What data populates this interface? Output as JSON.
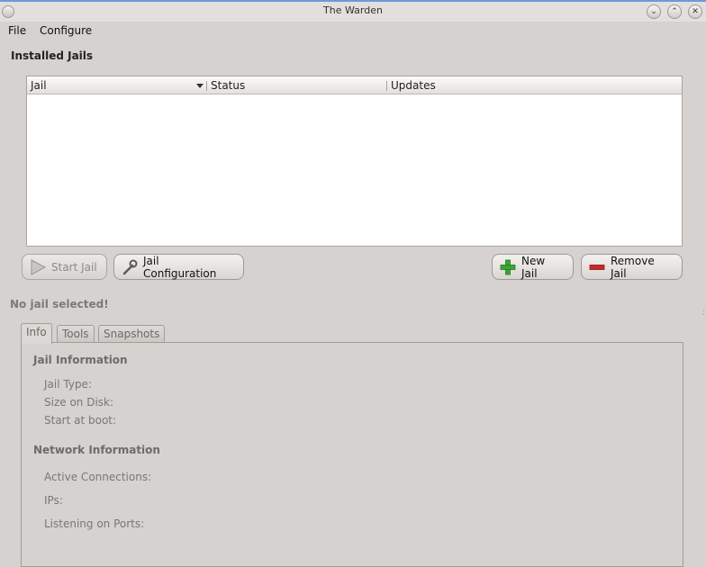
{
  "window": {
    "title": "The Warden"
  },
  "menu": {
    "file": "File",
    "configure": "Configure"
  },
  "installed_jails": {
    "title": "Installed Jails",
    "columns": [
      "Jail",
      "Status",
      "Updates"
    ]
  },
  "buttons": {
    "start_jail": "Start Jail",
    "jail_configuration": "Jail Configuration",
    "new_jail": "New Jail",
    "remove_jail": "Remove Jail"
  },
  "selection_status": "No jail selected!",
  "tabs": [
    "Info",
    "Tools",
    "Snapshots"
  ],
  "info": {
    "jail_information": {
      "heading": "Jail Information",
      "fields": [
        "Jail Type:",
        "Size on Disk:",
        "Start at boot:"
      ]
    },
    "network_information": {
      "heading": "Network Information",
      "fields": [
        "Active Connections:",
        "IPs:",
        "Listening on Ports:"
      ]
    }
  },
  "icons": {
    "start": "play-triangle-icon",
    "config": "wrench-icon",
    "new": "green-plus-icon",
    "remove": "red-minus-icon"
  },
  "colors": {
    "plus": "#3aa534",
    "minus": "#c8282a",
    "titlebar_accent": "#6e9ad1"
  }
}
